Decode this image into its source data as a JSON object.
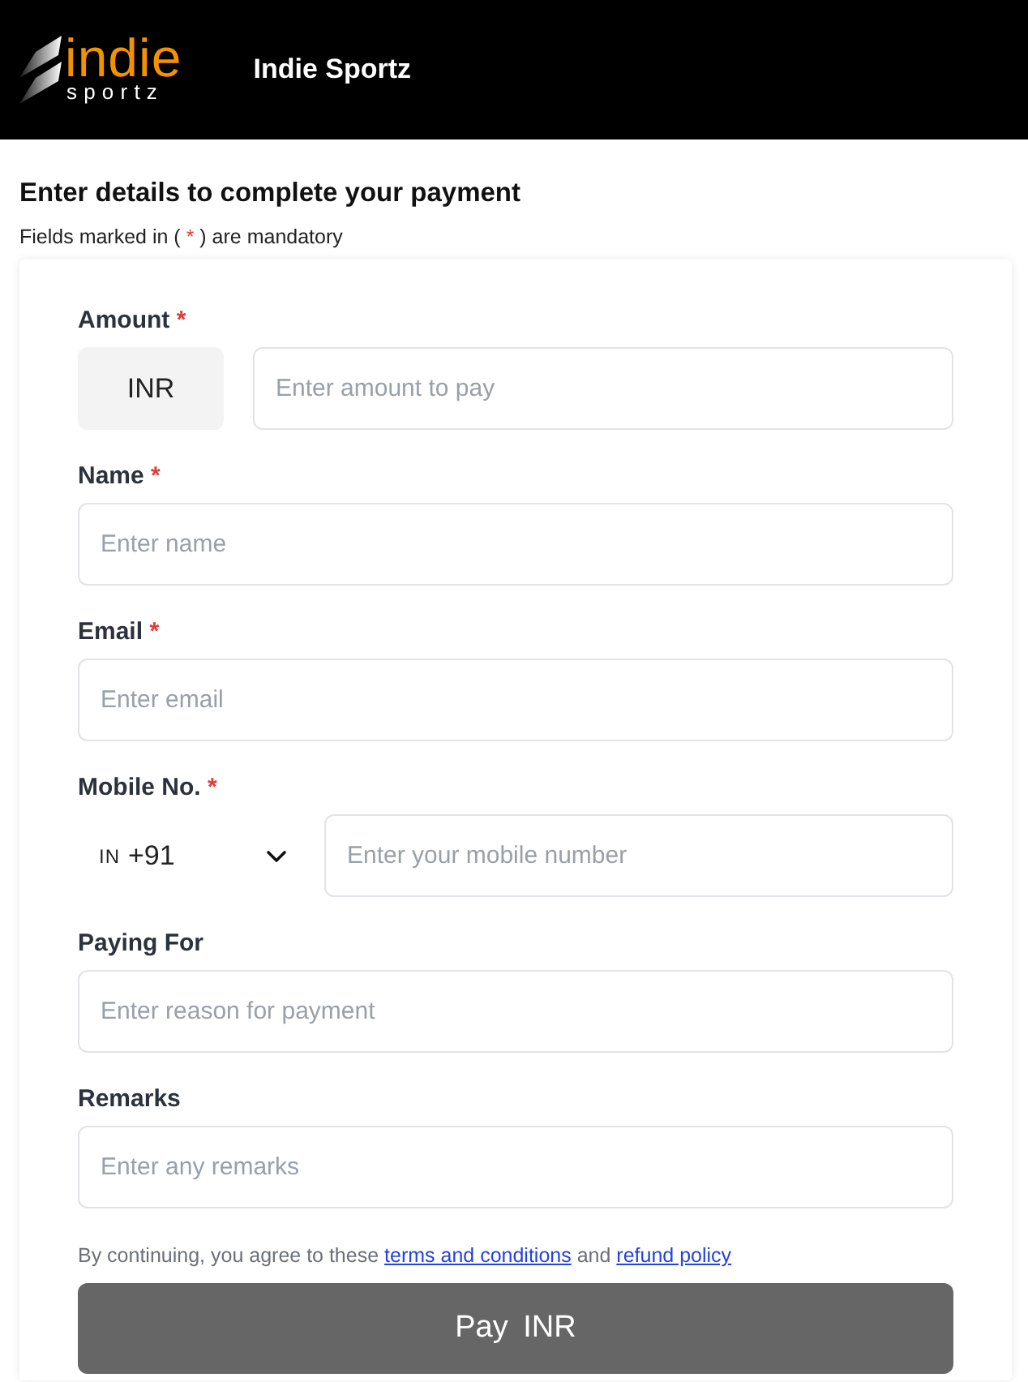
{
  "header": {
    "logo": {
      "top": "indie",
      "bottom": "sportz"
    },
    "title": "Indie Sportz"
  },
  "heading": "Enter details to complete your payment",
  "note": {
    "before": "Fields marked in ( ",
    "mark": "*",
    "after": " ) are mandatory"
  },
  "form": {
    "required_mark": "*",
    "fields": [
      {
        "kind": "amount",
        "label": "Amount",
        "required": true,
        "currency": "INR",
        "placeholder": "Enter amount to pay"
      },
      {
        "kind": "text",
        "label": "Name",
        "required": true,
        "placeholder": "Enter name"
      },
      {
        "kind": "text",
        "label": "Email",
        "required": true,
        "placeholder": "Enter email"
      },
      {
        "kind": "phone",
        "label": "Mobile No.",
        "required": true,
        "country_code": "IN",
        "dial_code": "+91",
        "placeholder": "Enter your mobile number"
      },
      {
        "kind": "text",
        "label": "Paying For",
        "required": false,
        "placeholder": "Enter reason for payment"
      },
      {
        "kind": "text",
        "label": "Remarks",
        "required": false,
        "placeholder": "Enter any remarks"
      }
    ],
    "consent": [
      {
        "kind": "text",
        "text": "By continuing, you agree to these "
      },
      {
        "kind": "link",
        "text": "terms and conditions"
      },
      {
        "kind": "text",
        "text": " and "
      },
      {
        "kind": "link",
        "text": "refund policy"
      }
    ],
    "submit": {
      "label": "Pay INR",
      "disabled": true
    }
  }
}
